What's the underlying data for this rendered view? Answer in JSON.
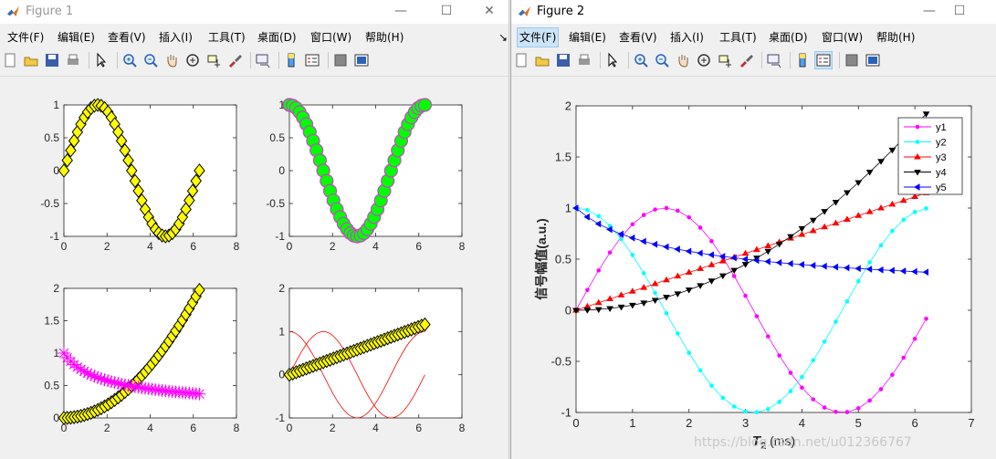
{
  "colors": {
    "matlab_icon": "#e07020",
    "selection": "#cce4f7",
    "yellow": "#ffff00",
    "magenta": "#ff00ff",
    "green": "#00ff00",
    "red": "#ff0000",
    "cyan": "#00ffff",
    "blue": "#0000ff"
  },
  "window1": {
    "title": "Figure 1",
    "controls": {
      "minimize": "—",
      "maximize": "☐",
      "close": "✕"
    },
    "menu": [
      "文件(F)",
      "编辑(E)",
      "查看(V)",
      "插入(I)",
      "工具(T)",
      "桌面(D)",
      "窗口(W)",
      "帮助(H)"
    ],
    "menu_arrow": "↘",
    "toolbar_icons": [
      "new-figure-icon",
      "open-file-icon",
      "save-icon",
      "print-icon",
      "separator",
      "edit-plot-icon",
      "separator",
      "zoom-in-icon",
      "zoom-out-icon",
      "pan-icon",
      "rotate-3d-icon",
      "data-cursor-icon",
      "brush-icon",
      "separator",
      "link-plot-icon",
      "separator",
      "colorbar-icon",
      "legend-icon",
      "separator",
      "hide-plot-tools-icon",
      "show-plot-tools-icon"
    ]
  },
  "window2": {
    "title": "Figure 2",
    "controls": {
      "minimize": "—",
      "maximize": "☐"
    },
    "menu": [
      "文件(F)",
      "编辑(E)",
      "查看(V)",
      "插入(I)",
      "工具(T)",
      "桌面(D)",
      "窗口(W)",
      "帮助(H)"
    ],
    "menu_selected": 0,
    "toolbar_icons": [
      "new-figure-icon",
      "open-file-icon",
      "save-icon",
      "print-icon",
      "separator",
      "edit-plot-icon",
      "separator",
      "zoom-in-icon",
      "zoom-out-icon",
      "pan-icon",
      "rotate-3d-icon",
      "data-cursor-icon",
      "brush-icon",
      "separator",
      "link-plot-icon",
      "separator",
      "colorbar-icon",
      "legend-icon",
      "separator",
      "hide-plot-tools-icon",
      "show-plot-tools-icon"
    ],
    "toolbar_pressed": "legend-icon"
  },
  "watermark": "https://blog.csdn.net/u012366767",
  "chart_data": [
    {
      "id": "fig1_sub1",
      "type": "line",
      "xlim": [
        0,
        8
      ],
      "ylim": [
        -1,
        1
      ],
      "xticks": [
        "0",
        "2",
        "4",
        "6",
        "8"
      ],
      "yticks": [
        "-1",
        "-0.5",
        "0",
        "0.5",
        "1"
      ],
      "series": [
        {
          "fn": "sin",
          "marker": "diamond",
          "color": "#ffff00",
          "x_range": [
            0,
            6.2832
          ],
          "n": 41
        }
      ]
    },
    {
      "id": "fig1_sub2",
      "type": "line",
      "xlim": [
        0,
        8
      ],
      "ylim": [
        -1,
        1
      ],
      "xticks": [
        "0",
        "2",
        "4",
        "6",
        "8"
      ],
      "yticks": [
        "-1",
        "-0.5",
        "0",
        "0.5",
        "1"
      ],
      "series": [
        {
          "fn": "cos",
          "marker": "circle",
          "color": "#00ff00",
          "edge": "#cc44cc",
          "x_range": [
            0,
            6.2832
          ],
          "n": 41
        }
      ]
    },
    {
      "id": "fig1_sub3",
      "type": "line",
      "xlim": [
        0,
        8
      ],
      "ylim": [
        0,
        2
      ],
      "xticks": [
        "0",
        "2",
        "4",
        "6",
        "8"
      ],
      "yticks": [
        "0",
        "0.5",
        "1",
        "1.5",
        "2"
      ],
      "series": [
        {
          "fn": "square_scaled",
          "marker": "diamond",
          "color": "#ffff00",
          "x_range": [
            0,
            6.2832
          ],
          "n": 41
        },
        {
          "fn": "inv_sqrt",
          "marker": "asterisk",
          "color": "#ff00ff",
          "x_range": [
            0,
            6.2832
          ],
          "n": 41
        }
      ]
    },
    {
      "id": "fig1_sub4",
      "type": "line",
      "xlim": [
        0,
        8
      ],
      "ylim": [
        -1,
        2
      ],
      "xticks": [
        "0",
        "2",
        "4",
        "6",
        "8"
      ],
      "yticks": [
        "-1",
        "0",
        "1",
        "2"
      ],
      "series": [
        {
          "fn": "sin",
          "marker": "none",
          "color": "#ff0000",
          "x_range": [
            0,
            6.2832
          ],
          "n": 60
        },
        {
          "fn": "cos",
          "marker": "none",
          "color": "#ff0000",
          "x_range": [
            0,
            6.2832
          ],
          "n": 60
        },
        {
          "fn": "linear",
          "marker": "diamond",
          "color": "#ffff00",
          "x_range": [
            0,
            6.2832
          ],
          "n": 41
        }
      ]
    },
    {
      "id": "fig2_main",
      "type": "line",
      "xlim": [
        0,
        7
      ],
      "ylim": [
        -1,
        2
      ],
      "xticks": [
        "0",
        "1",
        "2",
        "3",
        "4",
        "5",
        "6",
        "7"
      ],
      "yticks": [
        "-1",
        "-0.5",
        "0",
        "0.5",
        "1",
        "1.5",
        "2"
      ],
      "ylabel": "信号幅值(a.u.)",
      "xlabel_main": "T",
      "xlabel_sub": "2",
      "xlabel_unit": " (ms)",
      "legend": [
        "y1",
        "y2",
        "y3",
        "y4",
        "y5"
      ],
      "series": [
        {
          "name": "y1",
          "fn": "sin",
          "marker": "dot",
          "color": "#ff00ff",
          "x_range": [
            0,
            6.2
          ],
          "n": 32
        },
        {
          "name": "y2",
          "fn": "cos",
          "marker": "dot",
          "color": "#00ffff",
          "x_range": [
            0,
            6.2
          ],
          "n": 32
        },
        {
          "name": "y3",
          "fn": "linear",
          "marker": "triangle-up",
          "color": "#ff0000",
          "x_range": [
            0,
            6.2
          ],
          "n": 32
        },
        {
          "name": "y4",
          "fn": "square_scaled",
          "marker": "triangle-down",
          "color": "#000000",
          "x_range": [
            0,
            6.2
          ],
          "n": 32
        },
        {
          "name": "y5",
          "fn": "inv_sqrt",
          "marker": "triangle-left",
          "color": "#0000ff",
          "x_range": [
            0,
            6.2
          ],
          "n": 32
        }
      ]
    }
  ]
}
